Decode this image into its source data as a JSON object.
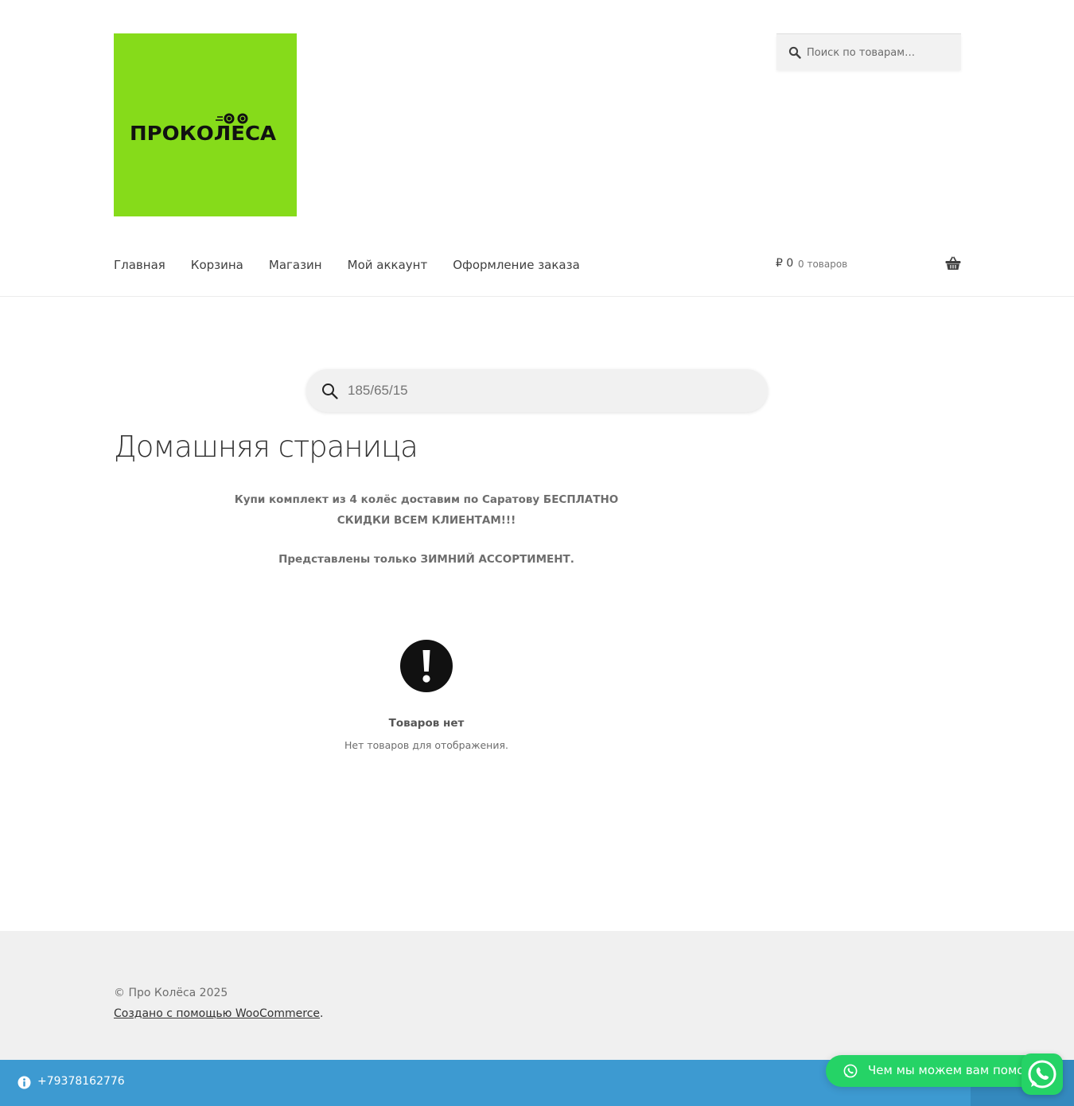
{
  "header": {
    "logo": {
      "text": "ПРОКОЛЕСА",
      "background_color": "#86db1a"
    },
    "search": {
      "placeholder": "Поиск по товарам…",
      "icon": "search-icon"
    },
    "nav": [
      {
        "label": "Главная"
      },
      {
        "label": "Корзина"
      },
      {
        "label": "Магазин"
      },
      {
        "label": "Мой аккаунт"
      },
      {
        "label": "Оформление заказа"
      }
    ],
    "cart": {
      "amount": "₽ 0",
      "count": "0 товаров",
      "icon": "basket-icon"
    }
  },
  "main": {
    "tyre_search": {
      "placeholder": "185/65/15",
      "icon": "search-icon"
    },
    "title": "Домашняя страница",
    "intro_lines": [
      "Купи комплект из 4 колёс доставим по Саратову БЕСПЛАТНО",
      "СКИДКИ ВСЕМ КЛИЕНТАМ!!!",
      "Представлены только ЗИМНИЙ АССОРТИМЕНТ."
    ],
    "empty_state": {
      "icon": "exclamation-circle-icon",
      "title": "Товаров нет",
      "text": "Нет товаров для отображения."
    }
  },
  "footer": {
    "copyright": "© Про Колёса 2025",
    "credit_link": "Создано с помощью WooCommerce",
    "credit_suffix": "."
  },
  "bottom_bar": {
    "icon": "info-icon",
    "phone": "+79378162776",
    "background_color": "#3d9ad1"
  },
  "whatsapp": {
    "bubble_text": "Чем мы можем вам помочь?",
    "icon": "whatsapp-icon",
    "color": "#25d366"
  }
}
